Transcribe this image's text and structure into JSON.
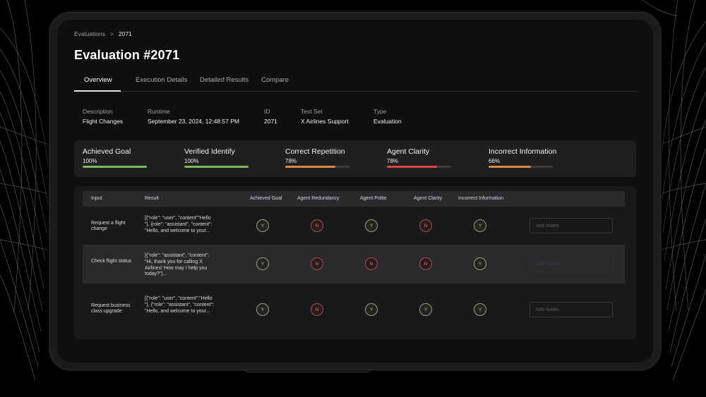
{
  "breadcrumb": {
    "parent": "Evaluations",
    "separator": ">",
    "current": "2071"
  },
  "page_title": "Evaluation #2071",
  "tabs": [
    "Overview",
    "Execution Details",
    "Detailed Results",
    "Compare"
  ],
  "meta": {
    "description_label": "Description",
    "description": "Flight Changes",
    "runtime_label": "Runtime",
    "runtime": "September 23, 2024, 12:48:57 PM",
    "id_label": "ID",
    "id": "2071",
    "testset_label": "Test Set",
    "testset": "X Airlines Support",
    "type_label": "Type",
    "type": "Evaluation"
  },
  "metrics": [
    {
      "name": "Achieved Goal",
      "value": "100%",
      "fraction": 1.0,
      "color": "#7fb85a"
    },
    {
      "name": "Verified Identify",
      "value": "100%",
      "fraction": 1.0,
      "color": "#7fb85a"
    },
    {
      "name": "Correct Repetition",
      "value": "78%",
      "fraction": 0.78,
      "color": "#d9884a"
    },
    {
      "name": "Agent Clarity",
      "value": "78%",
      "fraction": 0.78,
      "color": "#d9484a"
    },
    {
      "name": "Incorrect Information",
      "value": "66%",
      "fraction": 0.66,
      "color": "#d9884a"
    }
  ],
  "table": {
    "headers": [
      "Input",
      "Result",
      "Achieved Goal",
      "Agent Redundancy",
      "Agent Polite",
      "Agent Clarity",
      "Incorrect Information"
    ],
    "notes_placeholder": "Add Notes",
    "rows": [
      {
        "input": "Request a flight change",
        "result": "[{\"role\": \"user\", \"content\"\"Hello \"}, {role\": \"assistant\", \"content\": \"Hello, and welcome to your...",
        "marks": [
          "Y",
          "N",
          "Y",
          "N",
          "Y"
        ]
      },
      {
        "input": "Check flight status",
        "result": "[{\"role\": \"assistant\", \"content\": \"Hi, thank you for calling X Airlines! How may I help you today?\"}...",
        "marks": [
          "Y",
          "N",
          "N",
          "N",
          "Y"
        ]
      },
      {
        "input": "Request business class upgrade",
        "result": "[{\"role\": \"user\", \"content\":\"Hello \"}, {\"role\": \"assistant\", \"content\": \"Hello, and welcome to your...",
        "marks": [
          "Y",
          "N",
          "Y",
          "Y",
          "Y"
        ]
      }
    ]
  }
}
